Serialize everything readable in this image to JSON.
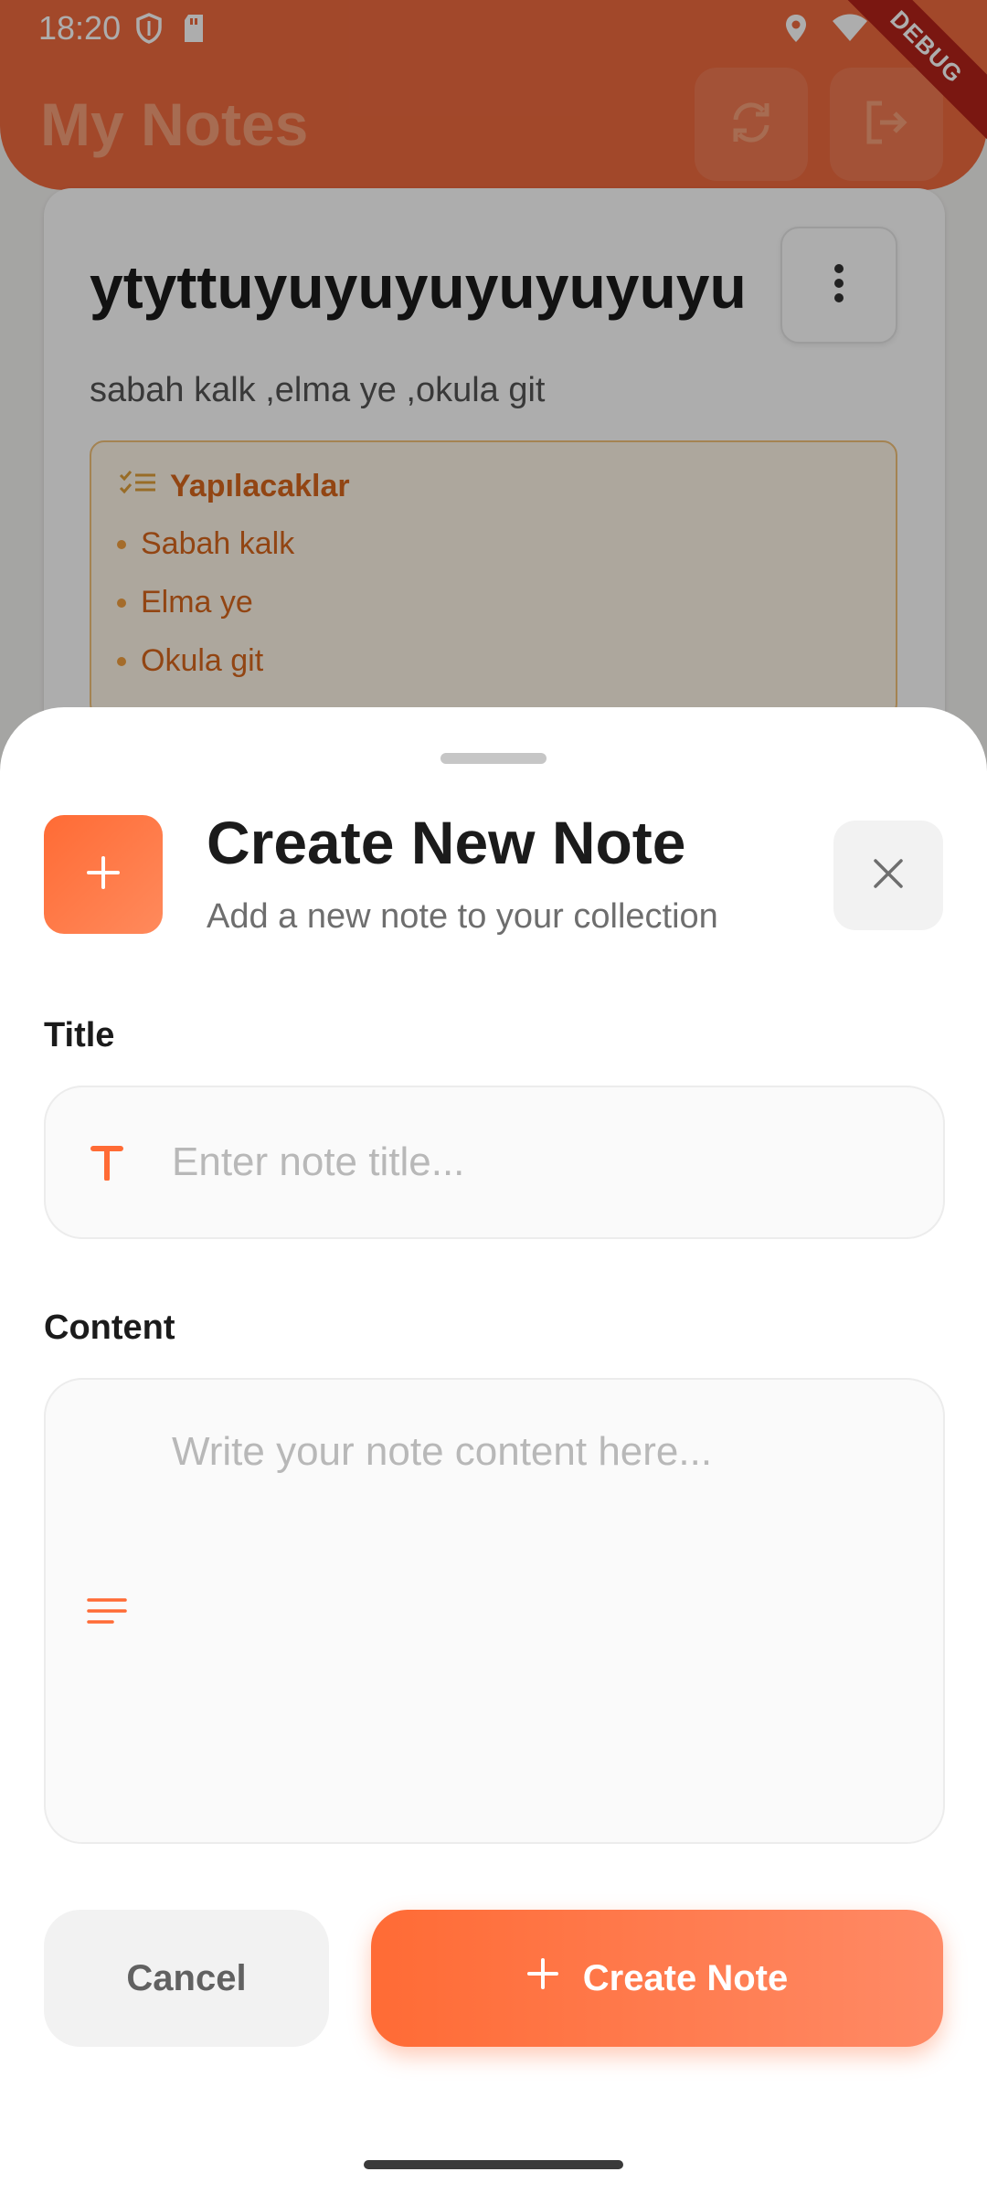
{
  "status_bar": {
    "time": "18:20",
    "debug_banner": "DEBUG"
  },
  "app": {
    "title": "My Notes",
    "accent_color": "#ff6b35"
  },
  "note_card": {
    "title": "ytyttuyuyuyuyuyuyuyu",
    "description": "sabah kalk ,elma ye ,okula git",
    "todo_header": "Yapılacaklar",
    "todo_items": [
      "Sabah kalk",
      "Elma ye",
      "Okula git"
    ]
  },
  "sheet": {
    "title": "Create New Note",
    "subtitle": "Add a new note to your collection",
    "title_label": "Title",
    "title_placeholder": "Enter note title...",
    "content_label": "Content",
    "content_placeholder": "Write your note content here...",
    "cancel_label": "Cancel",
    "create_label": "Create Note"
  }
}
